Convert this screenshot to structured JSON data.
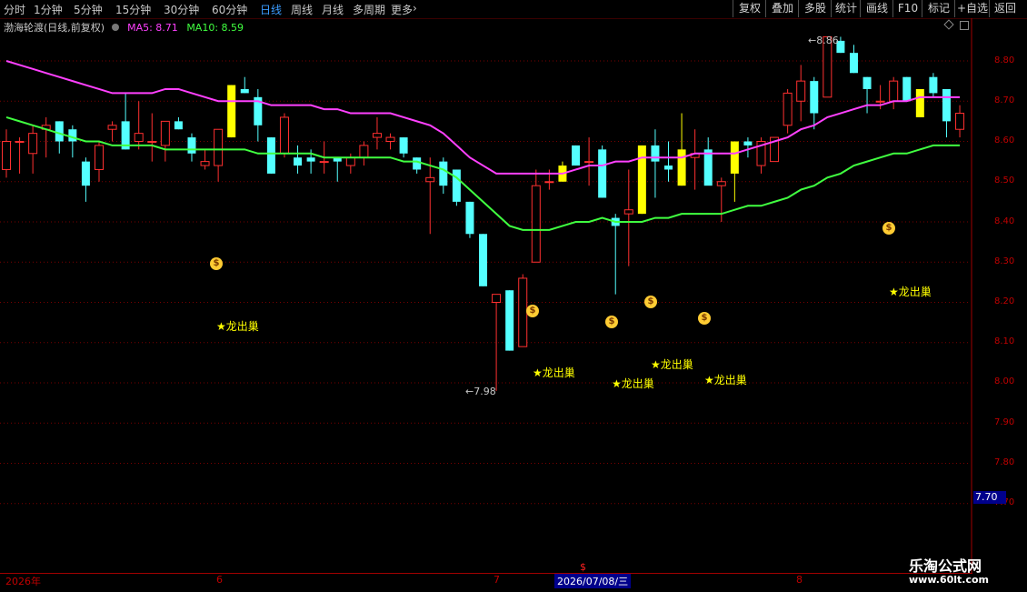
{
  "toolbar": {
    "tabs": [
      "分时",
      "1分钟",
      "5分钟",
      "15分钟",
      "30分钟",
      "60分钟",
      "日线",
      "周线",
      "月线",
      "多周期",
      "更多"
    ],
    "active_tab": "日线",
    "more_arrow": "›",
    "right_buttons": [
      "复权",
      "叠加",
      "多股",
      "统计",
      "画线",
      "F10",
      "标记",
      "+自选",
      "返回"
    ]
  },
  "info": {
    "stock_name": "渤海轮渡(日线,前复权)",
    "ma5_label": "MA5: 8.71",
    "ma10_label": "MA10: 8.59"
  },
  "y_axis": {
    "labels": [
      "8.80",
      "8.70",
      "8.60",
      "8.50",
      "8.40",
      "8.30",
      "8.20",
      "8.10",
      "8.00",
      "7.90",
      "7.80",
      "7.70"
    ],
    "current_price": "7.70"
  },
  "x_axis": {
    "year_label": "2026年",
    "month_labels": [
      "6",
      "7",
      "8"
    ],
    "cursor_date": "2026/07/08/三",
    "signal_mark": "$"
  },
  "annotations": {
    "high_label": "8.86",
    "low_label": "7.98",
    "signal_text": "★龙出巢"
  },
  "colors": {
    "up": "#ff3030",
    "down": "#54ffff",
    "signal": "#ffff00",
    "ma5": "#ff40ff",
    "ma10": "#40ff40",
    "axis": "#a00000",
    "active_tab": "#3b9cff"
  },
  "watermark": {
    "title": "乐淘公式网",
    "url": "www.60lt.com"
  },
  "chart_data": {
    "type": "candlestick",
    "y_range": [
      7.66,
      8.9
    ],
    "candles": [
      {
        "o": 8.53,
        "h": 8.63,
        "l": 8.51,
        "c": 8.6
      },
      {
        "o": 8.6,
        "h": 8.61,
        "l": 8.52,
        "c": 8.6
      },
      {
        "o": 8.57,
        "h": 8.64,
        "l": 8.52,
        "c": 8.62
      },
      {
        "o": 8.63,
        "h": 8.66,
        "l": 8.56,
        "c": 8.64
      },
      {
        "o": 8.65,
        "h": 8.65,
        "l": 8.57,
        "c": 8.6
      },
      {
        "o": 8.63,
        "h": 8.64,
        "l": 8.56,
        "c": 8.6
      },
      {
        "o": 8.55,
        "h": 8.56,
        "l": 8.45,
        "c": 8.49
      },
      {
        "o": 8.53,
        "h": 8.6,
        "l": 8.5,
        "c": 8.59
      },
      {
        "o": 8.63,
        "h": 8.65,
        "l": 8.6,
        "c": 8.64
      },
      {
        "o": 8.65,
        "h": 8.72,
        "l": 8.58,
        "c": 8.58
      },
      {
        "o": 8.6,
        "h": 8.7,
        "l": 8.58,
        "c": 8.62
      },
      {
        "o": 8.6,
        "h": 8.67,
        "l": 8.55,
        "c": 8.6
      },
      {
        "o": 8.59,
        "h": 8.65,
        "l": 8.55,
        "c": 8.65
      },
      {
        "o": 8.65,
        "h": 8.66,
        "l": 8.63,
        "c": 8.63
      },
      {
        "o": 8.61,
        "h": 8.62,
        "l": 8.55,
        "c": 8.57
      },
      {
        "o": 8.54,
        "h": 8.58,
        "l": 8.53,
        "c": 8.55
      },
      {
        "o": 8.54,
        "h": 8.63,
        "l": 8.5,
        "c": 8.63
      },
      {
        "o": 8.61,
        "h": 8.74,
        "l": 8.61,
        "c": 8.74,
        "sig": 1
      },
      {
        "o": 8.73,
        "h": 8.76,
        "l": 8.72,
        "c": 8.72
      },
      {
        "o": 8.71,
        "h": 8.73,
        "l": 8.6,
        "c": 8.64
      },
      {
        "o": 8.61,
        "h": 8.61,
        "l": 8.52,
        "c": 8.52
      },
      {
        "o": 8.57,
        "h": 8.67,
        "l": 8.56,
        "c": 8.66
      },
      {
        "o": 8.56,
        "h": 8.59,
        "l": 8.52,
        "c": 8.54
      },
      {
        "o": 8.56,
        "h": 8.58,
        "l": 8.52,
        "c": 8.55
      },
      {
        "o": 8.55,
        "h": 8.6,
        "l": 8.52,
        "c": 8.55
      },
      {
        "o": 8.56,
        "h": 8.56,
        "l": 8.5,
        "c": 8.55
      },
      {
        "o": 8.54,
        "h": 8.57,
        "l": 8.52,
        "c": 8.56
      },
      {
        "o": 8.56,
        "h": 8.6,
        "l": 8.54,
        "c": 8.59
      },
      {
        "o": 8.61,
        "h": 8.66,
        "l": 8.58,
        "c": 8.62
      },
      {
        "o": 8.6,
        "h": 8.62,
        "l": 8.58,
        "c": 8.61
      },
      {
        "o": 8.61,
        "h": 8.61,
        "l": 8.56,
        "c": 8.57
      },
      {
        "o": 8.56,
        "h": 8.56,
        "l": 8.52,
        "c": 8.53
      },
      {
        "o": 8.5,
        "h": 8.56,
        "l": 8.37,
        "c": 8.51
      },
      {
        "o": 8.55,
        "h": 8.56,
        "l": 8.47,
        "c": 8.49
      },
      {
        "o": 8.53,
        "h": 8.53,
        "l": 8.44,
        "c": 8.45
      },
      {
        "o": 8.45,
        "h": 8.45,
        "l": 8.36,
        "c": 8.37
      },
      {
        "o": 8.37,
        "h": 8.37,
        "l": 8.24,
        "c": 8.24
      },
      {
        "o": 8.2,
        "h": 8.22,
        "l": 7.98,
        "c": 8.22
      },
      {
        "o": 8.23,
        "h": 8.23,
        "l": 8.08,
        "c": 8.08
      },
      {
        "o": 8.09,
        "h": 8.27,
        "l": 8.09,
        "c": 8.26
      },
      {
        "o": 8.3,
        "h": 8.53,
        "l": 8.3,
        "c": 8.49
      },
      {
        "o": 8.5,
        "h": 8.53,
        "l": 8.48,
        "c": 8.5
      },
      {
        "o": 8.5,
        "h": 8.55,
        "l": 8.5,
        "c": 8.54,
        "sig": 1
      },
      {
        "o": 8.59,
        "h": 8.59,
        "l": 8.54,
        "c": 8.54
      },
      {
        "o": 8.55,
        "h": 8.61,
        "l": 8.49,
        "c": 8.55
      },
      {
        "o": 8.58,
        "h": 8.59,
        "l": 8.46,
        "c": 8.46
      },
      {
        "o": 8.41,
        "h": 8.42,
        "l": 8.22,
        "c": 8.39
      },
      {
        "o": 8.42,
        "h": 8.53,
        "l": 8.29,
        "c": 8.43
      },
      {
        "o": 8.42,
        "h": 8.59,
        "l": 8.42,
        "c": 8.59,
        "sig": 1
      },
      {
        "o": 8.59,
        "h": 8.63,
        "l": 8.46,
        "c": 8.55
      },
      {
        "o": 8.54,
        "h": 8.6,
        "l": 8.5,
        "c": 8.53
      },
      {
        "o": 8.49,
        "h": 8.67,
        "l": 8.49,
        "c": 8.58,
        "sig": 1
      },
      {
        "o": 8.56,
        "h": 8.63,
        "l": 8.48,
        "c": 8.57
      },
      {
        "o": 8.58,
        "h": 8.61,
        "l": 8.5,
        "c": 8.49
      },
      {
        "o": 8.49,
        "h": 8.51,
        "l": 8.4,
        "c": 8.5
      },
      {
        "o": 8.52,
        "h": 8.58,
        "l": 8.45,
        "c": 8.6,
        "sig": 1
      },
      {
        "o": 8.6,
        "h": 8.61,
        "l": 8.56,
        "c": 8.59
      },
      {
        "o": 8.54,
        "h": 8.61,
        "l": 8.52,
        "c": 8.6
      },
      {
        "o": 8.55,
        "h": 8.61,
        "l": 8.55,
        "c": 8.61
      },
      {
        "o": 8.64,
        "h": 8.73,
        "l": 8.62,
        "c": 8.72
      },
      {
        "o": 8.7,
        "h": 8.79,
        "l": 8.65,
        "c": 8.75
      },
      {
        "o": 8.75,
        "h": 8.76,
        "l": 8.63,
        "c": 8.67
      },
      {
        "o": 8.71,
        "h": 8.86,
        "l": 8.71,
        "c": 8.86
      },
      {
        "o": 8.85,
        "h": 8.86,
        "l": 8.82,
        "c": 8.82
      },
      {
        "o": 8.82,
        "h": 8.84,
        "l": 8.77,
        "c": 8.77
      },
      {
        "o": 8.76,
        "h": 8.76,
        "l": 8.67,
        "c": 8.73
      },
      {
        "o": 8.7,
        "h": 8.74,
        "l": 8.68,
        "c": 8.7
      },
      {
        "o": 8.7,
        "h": 8.76,
        "l": 8.68,
        "c": 8.75
      },
      {
        "o": 8.76,
        "h": 8.76,
        "l": 8.7,
        "c": 8.7
      },
      {
        "o": 8.73,
        "h": 8.73,
        "l": 8.66,
        "c": 8.66,
        "sig": 1
      },
      {
        "o": 8.76,
        "h": 8.77,
        "l": 8.71,
        "c": 8.72
      },
      {
        "o": 8.73,
        "h": 8.73,
        "l": 8.61,
        "c": 8.65
      },
      {
        "o": 8.63,
        "h": 8.69,
        "l": 8.61,
        "c": 8.67
      }
    ],
    "ma5": [
      8.8,
      8.79,
      8.78,
      8.77,
      8.76,
      8.75,
      8.74,
      8.73,
      8.72,
      8.72,
      8.72,
      8.72,
      8.73,
      8.73,
      8.72,
      8.71,
      8.7,
      8.7,
      8.7,
      8.7,
      8.69,
      8.69,
      8.69,
      8.69,
      8.68,
      8.68,
      8.67,
      8.67,
      8.67,
      8.67,
      8.66,
      8.65,
      8.64,
      8.62,
      8.59,
      8.56,
      8.54,
      8.52,
      8.52,
      8.52,
      8.52,
      8.52,
      8.52,
      8.53,
      8.54,
      8.54,
      8.55,
      8.55,
      8.56,
      8.56,
      8.56,
      8.56,
      8.57,
      8.57,
      8.57,
      8.57,
      8.58,
      8.59,
      8.6,
      8.61,
      8.63,
      8.64,
      8.66,
      8.67,
      8.68,
      8.69,
      8.69,
      8.7,
      8.7,
      8.71,
      8.71,
      8.71,
      8.71
    ],
    "ma10": [
      8.66,
      8.65,
      8.64,
      8.63,
      8.62,
      8.61,
      8.6,
      8.6,
      8.59,
      8.59,
      8.59,
      8.59,
      8.58,
      8.58,
      8.58,
      8.58,
      8.58,
      8.58,
      8.58,
      8.57,
      8.57,
      8.57,
      8.57,
      8.57,
      8.56,
      8.56,
      8.56,
      8.56,
      8.56,
      8.56,
      8.55,
      8.55,
      8.54,
      8.53,
      8.51,
      8.48,
      8.45,
      8.42,
      8.39,
      8.38,
      8.38,
      8.38,
      8.39,
      8.4,
      8.4,
      8.41,
      8.4,
      8.4,
      8.4,
      8.41,
      8.41,
      8.42,
      8.42,
      8.42,
      8.42,
      8.43,
      8.44,
      8.44,
      8.45,
      8.46,
      8.48,
      8.49,
      8.51,
      8.52,
      8.54,
      8.55,
      8.56,
      8.57,
      8.57,
      8.58,
      8.59,
      8.59,
      8.59
    ]
  }
}
